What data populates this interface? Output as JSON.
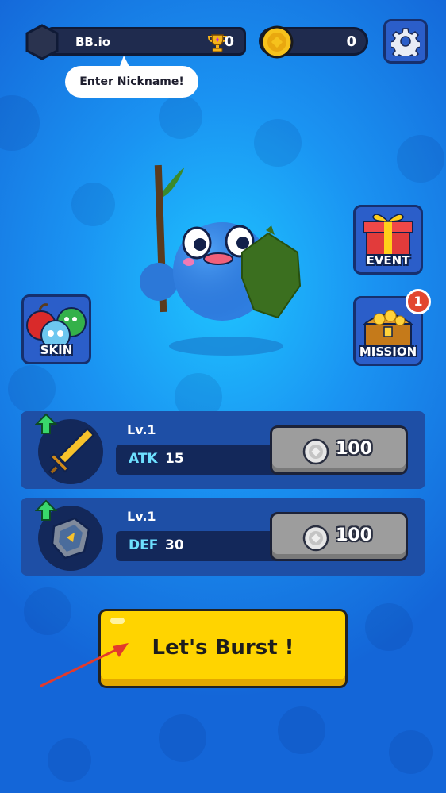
{
  "profile": {
    "name": "BB.io",
    "trophies": "0",
    "nickname_hint": "Enter Nickname!"
  },
  "currency": {
    "coins": "0"
  },
  "side_buttons": {
    "skin": "SKIN",
    "event": "EVENT",
    "mission": "MISSION",
    "mission_badge": "1"
  },
  "upgrades": [
    {
      "level": "Lv.1",
      "stat": "ATK",
      "value": "15",
      "price": "100",
      "icon": "sword-icon"
    },
    {
      "level": "Lv.1",
      "stat": "DEF",
      "value": "30",
      "price": "100",
      "icon": "shield-icon"
    }
  ],
  "play": {
    "label": "Let's Burst !"
  },
  "colors": {
    "background": "#1a93f2",
    "play_button": "#ffd400",
    "stat_label": "#6ee0ff",
    "badge": "#e2472f"
  }
}
